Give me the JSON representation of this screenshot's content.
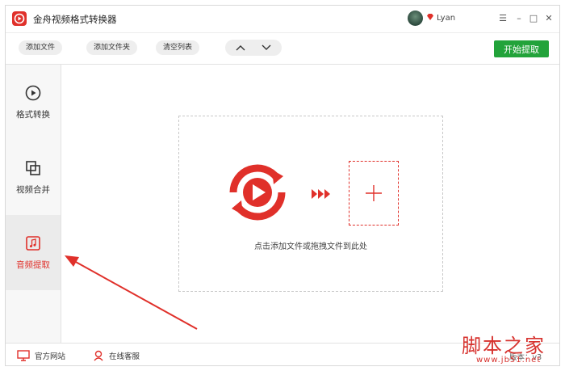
{
  "app": {
    "title": "金舟视频格式转换器",
    "user_name": "Lyan"
  },
  "window_controls": {
    "menu": "☰",
    "minimize": "–",
    "maximize": "□",
    "close": "✕"
  },
  "toolbar": {
    "add_file": "添加文件",
    "add_folder": "添加文件夹",
    "clear_list": "清空列表",
    "start_button": "开始提取"
  },
  "sidebar": {
    "items": [
      {
        "label": "格式转换",
        "icon": "play-circle-icon",
        "active": false
      },
      {
        "label": "视频合并",
        "icon": "merge-squares-icon",
        "active": false
      },
      {
        "label": "音频提取",
        "icon": "music-note-icon",
        "active": true
      }
    ]
  },
  "main": {
    "hint": "点击添加文件或拖拽文件到此处"
  },
  "bottom": {
    "official_site": "官方网站",
    "online_service": "在线客服",
    "version": "版本：v3"
  },
  "watermark": {
    "main": "脚本之家",
    "sub": "www.jb51.net"
  },
  "colors": {
    "accent_red": "#e0302a",
    "start_green": "#22a33a"
  }
}
